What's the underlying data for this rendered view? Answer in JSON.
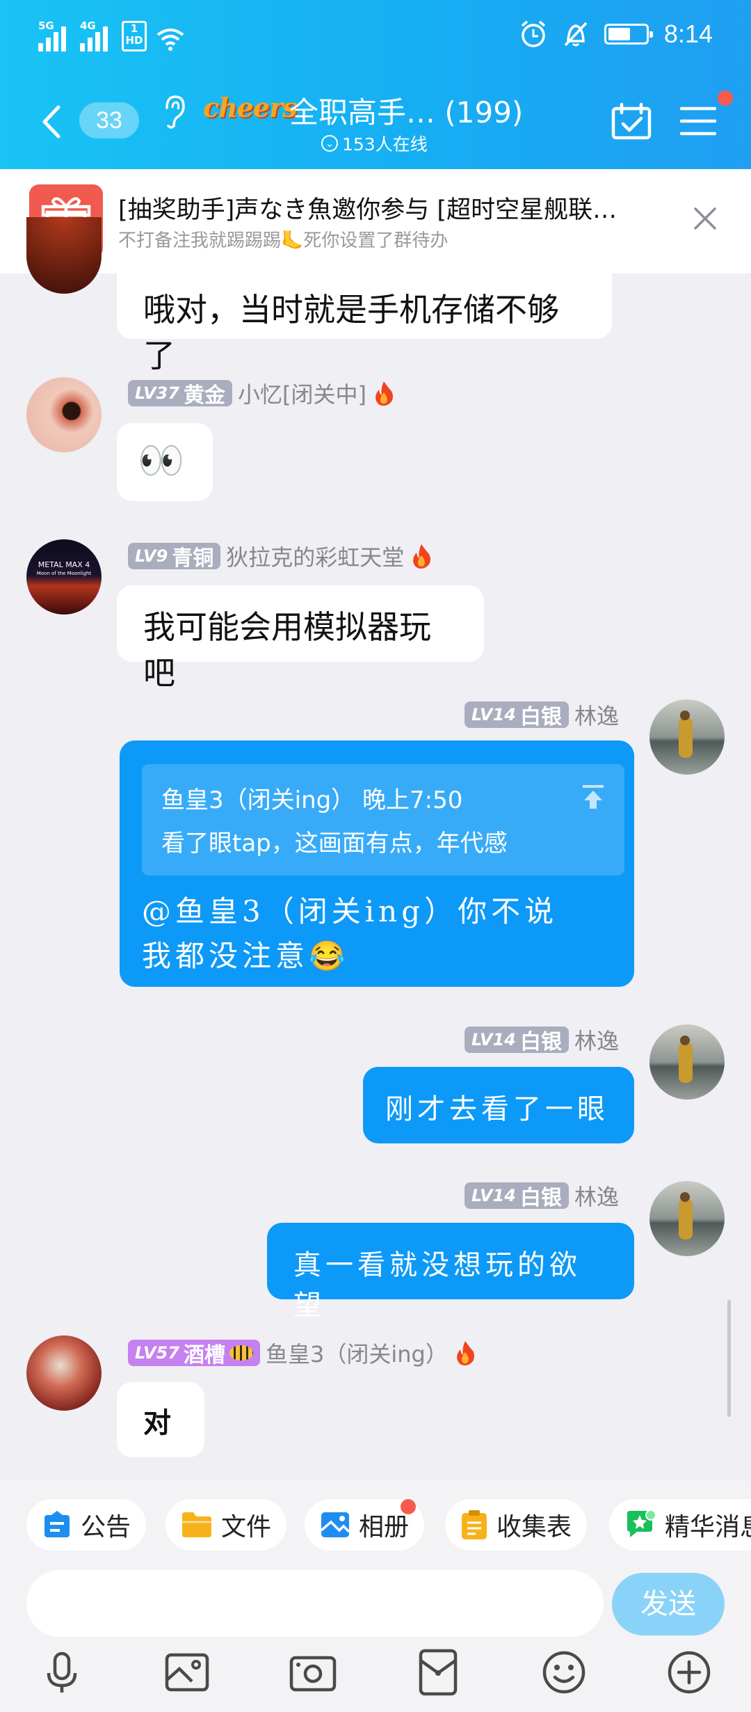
{
  "status_bar": {
    "signal1": "5G",
    "signal2": "4G",
    "hd_top": "1",
    "hd_bottom": "HD",
    "time": "8:14",
    "battery_level": 0.54
  },
  "header": {
    "unread_count": "33",
    "group_prefix_logo": "cheers",
    "group_name": "全职高手…",
    "member_count": "(199)",
    "online_text": "153人在线"
  },
  "notice": {
    "title": "[抽奖助手]声なき魚邀你参与 [超时空星舰联…",
    "subtitle": "不打备注我就踢踢踢🦶死你设置了群待办"
  },
  "messages": [
    {
      "text": "哦对，当时就是手机存储不够了"
    },
    {
      "level": "LV37",
      "rank": "黄金",
      "name": "小忆[闭关中]",
      "text": "👀"
    },
    {
      "level": "LV9",
      "rank": "青铜",
      "name": "狄拉克的彩虹天堂",
      "avatar_text1": "METAL MAX 4",
      "avatar_text2": "Moon of the Moonlight",
      "text": "我可能会用模拟器玩吧"
    },
    {
      "level": "LV14",
      "rank": "白银",
      "name": "林逸",
      "quote_author_time": "鱼皇3（闭关ing） 晚上7:50",
      "quote_text": "看了眼tap，这画面有点，年代感",
      "text": "@鱼皇3（闭关ing）你不说我都没注意😂"
    },
    {
      "level": "LV14",
      "rank": "白银",
      "name": "林逸",
      "text": "刚才去看了一眼"
    },
    {
      "level": "LV14",
      "rank": "白银",
      "name": "林逸",
      "text": "真一看就没想玩的欲望"
    },
    {
      "level": "LV57",
      "rank": "酒槽",
      "name": "鱼皇3（闭关ing）",
      "text": "对"
    }
  ],
  "shortcuts": [
    "公告",
    "文件",
    "相册",
    "收集表",
    "精华消息"
  ],
  "composer": {
    "send_label": "发送"
  },
  "colors": {
    "accent": "#0d99f7",
    "header": "#16aef3",
    "badge_red": "#f65c4d"
  }
}
